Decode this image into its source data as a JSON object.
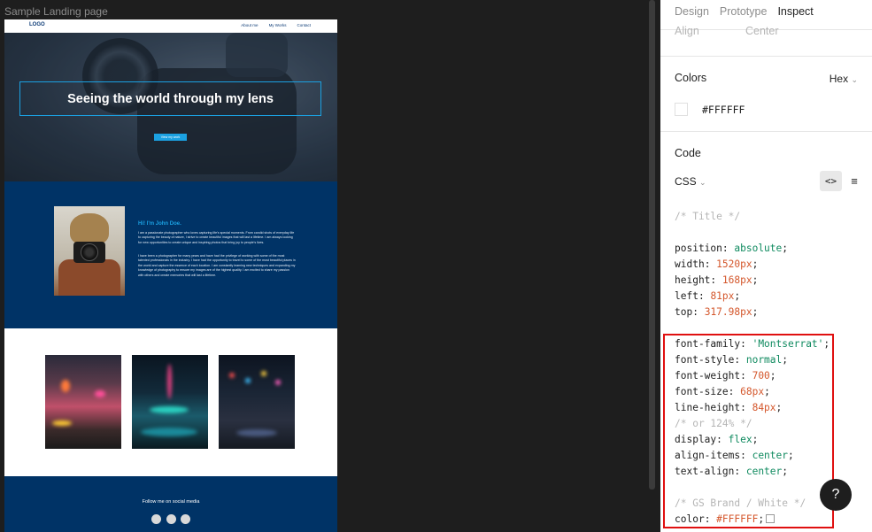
{
  "canvas": {
    "frame_label": "Sample Landing page"
  },
  "site": {
    "nav": {
      "logo": "LOGO",
      "links": [
        "About me",
        "My Works",
        "Contact"
      ]
    },
    "hero": {
      "title": "Seeing the world through my lens",
      "button": "View my work"
    },
    "about": {
      "heading": "Hi! I'm John Doe.",
      "paragraph1": "I am a passionate photographer who loves capturing life's special moments. From candid shots of everyday life to capturing the beauty of nature, I strive to create beautiful images that will last a lifetime. I am always looking for new opportunities to create unique and inspiring photos that bring joy to people's lives.",
      "paragraph2": "I have been a photographer for many years and have had the privilege of working with some of the most talented professionals in the industry. I have had the opportunity to travel to some of the most beautiful places in the world and capture the essence of each location. I am constantly learning new techniques and expanding my knowledge of photography to ensure my images are of the highest quality. I am excited to share my passion with others and create memories that will last a lifetime."
    },
    "footer": {
      "text": "Follow me on social media"
    }
  },
  "panel": {
    "tabs": [
      {
        "label": "Design",
        "active": false
      },
      {
        "label": "Prototype",
        "active": false
      },
      {
        "label": "Inspect",
        "active": true
      }
    ],
    "align": {
      "label": "Align",
      "value": "Center"
    },
    "colors": {
      "title": "Colors",
      "format": "Hex",
      "value": "#FFFFFF"
    },
    "code": {
      "title": "Code",
      "language": "CSS",
      "lines": [
        {
          "prop": "/* Title */",
          "comment": true
        },
        {
          "prop": "",
          "blank": true
        },
        {
          "prop": "position",
          "value": "absolute",
          "kind": "k"
        },
        {
          "prop": "width",
          "value": "1520px",
          "kind": "n"
        },
        {
          "prop": "height",
          "value": "168px",
          "kind": "n"
        },
        {
          "prop": "left",
          "value": "81px",
          "kind": "n"
        },
        {
          "prop": "top",
          "value": "317.98px",
          "kind": "n"
        },
        {
          "prop": "",
          "blank": true
        },
        {
          "prop": "font-family",
          "value": "'Montserrat'",
          "kind": "s"
        },
        {
          "prop": "font-style",
          "value": "normal",
          "kind": "k"
        },
        {
          "prop": "font-weight",
          "value": "700",
          "kind": "n"
        },
        {
          "prop": "font-size",
          "value": "68px",
          "kind": "n"
        },
        {
          "prop": "line-height",
          "value": "84px",
          "kind": "n"
        },
        {
          "prop": "/* or 124% */",
          "comment": true
        },
        {
          "prop": "display",
          "value": "flex",
          "kind": "k"
        },
        {
          "prop": "align-items",
          "value": "center",
          "kind": "k"
        },
        {
          "prop": "text-align",
          "value": "center",
          "kind": "k"
        },
        {
          "prop": "",
          "blank": true
        },
        {
          "prop": "/* GS Brand / White */",
          "comment": true
        },
        {
          "prop": "color",
          "value": "#FFFFFF",
          "kind": "n",
          "swatch": true
        }
      ]
    },
    "help": "?"
  },
  "colors": {
    "accent": "#1BA1E2",
    "brand_navy": "#003366",
    "highlight": "#E01010"
  }
}
